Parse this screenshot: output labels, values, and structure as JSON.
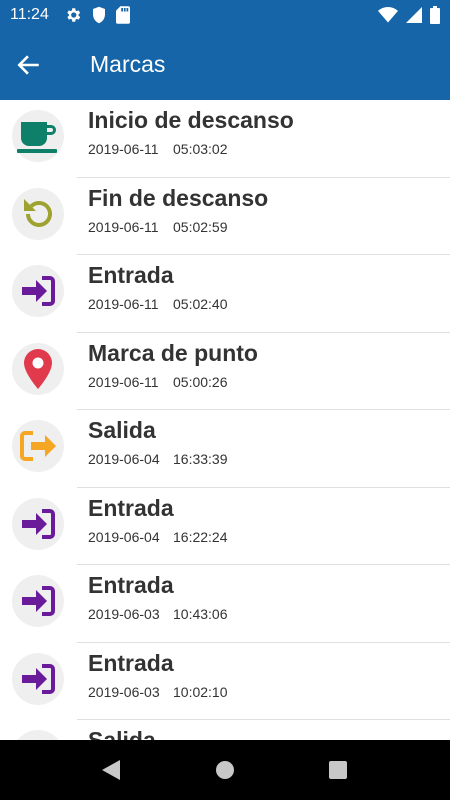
{
  "status_bar": {
    "time": "11:24",
    "left_icons": [
      "gear-icon",
      "shield-icon",
      "sd-card-icon"
    ],
    "right_icons": [
      "wifi-icon",
      "signal-icon",
      "battery-icon"
    ]
  },
  "app_bar": {
    "title": "Marcas",
    "back_icon": "arrow-back-icon",
    "color": "#1565a8"
  },
  "marks": [
    {
      "title": "Inicio de descanso",
      "date": "2019-06-11",
      "time": "05:03:02",
      "icon": "coffee-cup-icon",
      "color": "#0e7f68"
    },
    {
      "title": "Fin de descanso",
      "date": "2019-06-11",
      "time": "05:02:59",
      "icon": "undo-icon",
      "color": "#9ea22e"
    },
    {
      "title": "Entrada",
      "date": "2019-06-11",
      "time": "05:02:40",
      "icon": "login-icon",
      "color": "#6a1b9a"
    },
    {
      "title": "Marca de punto",
      "date": "2019-06-11",
      "time": "05:00:26",
      "icon": "map-pin-icon",
      "color": "#e03a4c"
    },
    {
      "title": "Salida",
      "date": "2019-06-04",
      "time": "16:33:39",
      "icon": "logout-icon",
      "color": "#f5a623"
    },
    {
      "title": "Entrada",
      "date": "2019-06-04",
      "time": "16:22:24",
      "icon": "login-icon",
      "color": "#6a1b9a"
    },
    {
      "title": "Entrada",
      "date": "2019-06-03",
      "time": "10:43:06",
      "icon": "login-icon",
      "color": "#6a1b9a"
    },
    {
      "title": "Entrada",
      "date": "2019-06-03",
      "time": "10:02:10",
      "icon": "login-icon",
      "color": "#6a1b9a"
    },
    {
      "title": "Salida",
      "date": "",
      "time": "",
      "icon": "logout-icon",
      "color": "#f5a623"
    }
  ],
  "nav_bar": {
    "buttons": [
      "back-triangle-icon",
      "home-circle-icon",
      "recents-square-icon"
    ]
  }
}
